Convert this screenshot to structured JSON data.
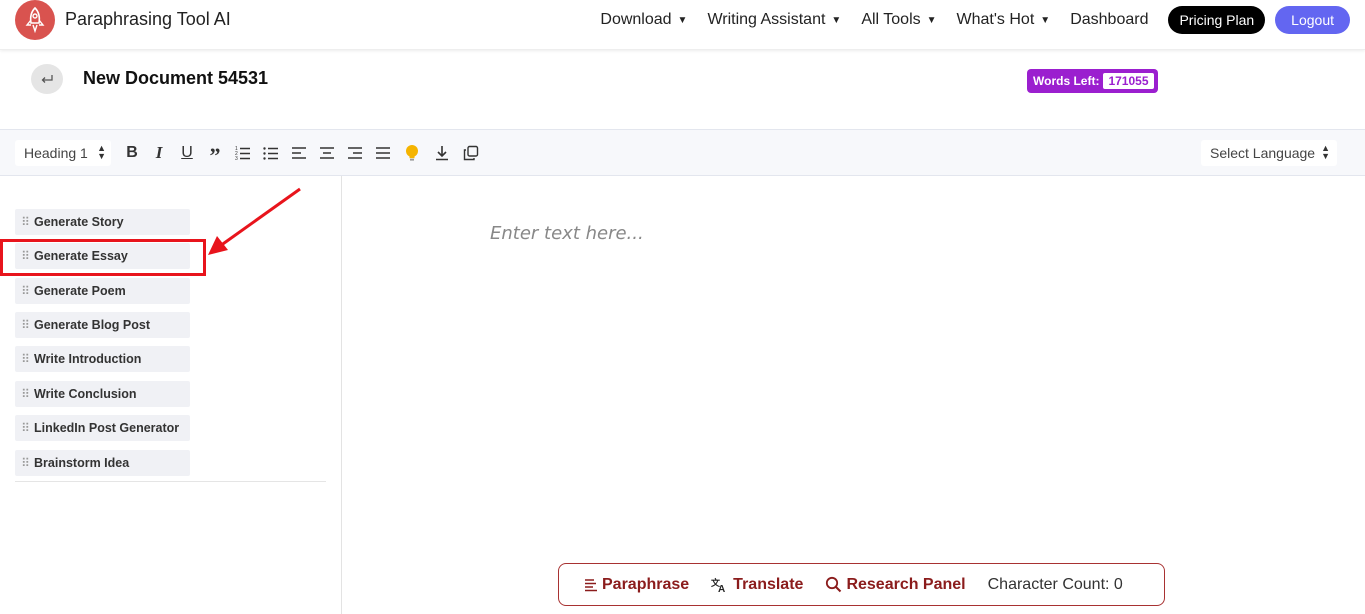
{
  "header": {
    "brand": "Paraphrasing Tool AI",
    "nav": [
      {
        "label": "Download",
        "caret": "▼"
      },
      {
        "label": "Writing Assistant",
        "caret": "▼"
      },
      {
        "label": "All Tools",
        "caret": "▼"
      },
      {
        "label": "What's Hot",
        "caret": "▼"
      },
      {
        "label": "Dashboard"
      }
    ],
    "pricing_label": "Pricing Plan",
    "logout_label": "Logout"
  },
  "document": {
    "title": "New Document 54531",
    "words_left_label": "Words Left:",
    "words_left_value": "171055"
  },
  "toolbar": {
    "heading_value": "Heading 1",
    "language_value": "Select Language",
    "tools": [
      "bold-icon",
      "italic-icon",
      "underline-icon",
      "quote-icon",
      "ordered-list-icon",
      "bullet-list-icon",
      "align-left-icon",
      "align-center-icon",
      "align-right-icon",
      "align-justify-icon",
      "lightbulb-icon",
      "download-icon",
      "copy-icon"
    ]
  },
  "sidebar": {
    "items": [
      {
        "label": "Generate Story"
      },
      {
        "label": "Generate Essay"
      },
      {
        "label": "Generate Poem"
      },
      {
        "label": "Generate Blog Post"
      },
      {
        "label": "Write Introduction"
      },
      {
        "label": "Write Conclusion"
      },
      {
        "label": "LinkedIn Post Generator"
      },
      {
        "label": "Brainstorm Idea"
      }
    ]
  },
  "editor": {
    "placeholder": "Enter text here..."
  },
  "actions": {
    "paraphrase": "Paraphrase",
    "translate": "Translate",
    "research": "Research Panel",
    "char_count": "Character Count: 0"
  },
  "colors": {
    "accent_purple": "#9b1fcf",
    "logout_blue": "#6366f1",
    "action_red": "#8b1c1c",
    "highlight_red": "#e8141c"
  }
}
